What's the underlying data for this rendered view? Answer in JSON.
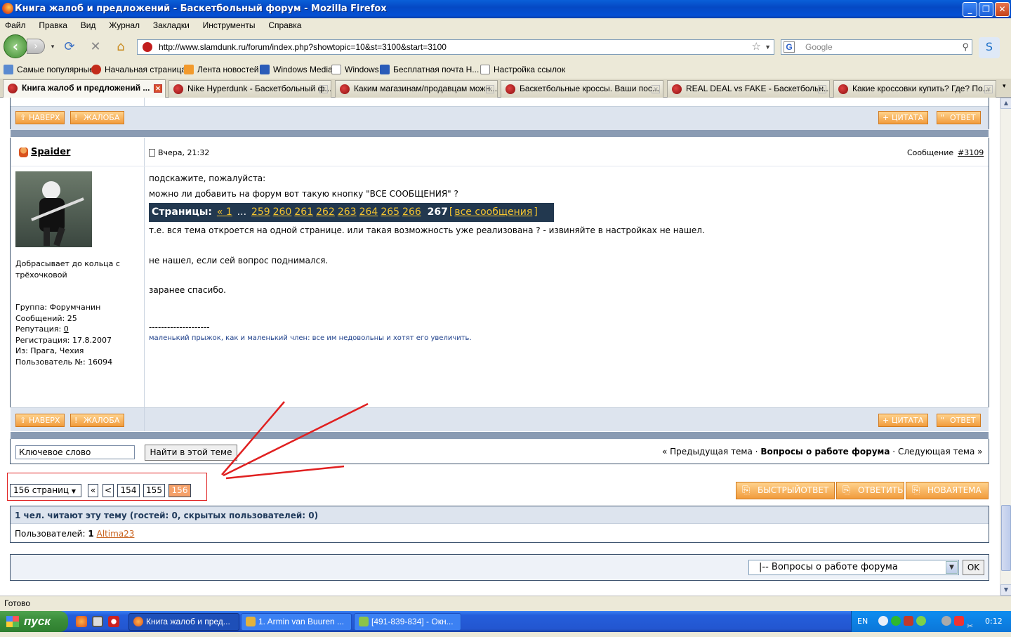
{
  "window": {
    "title": "Книга жалоб и предложений - Баскетбольный форум - Mozilla Firefox",
    "minimize": "_",
    "maximize": "❐",
    "close": "✕"
  },
  "menu": [
    "Файл",
    "Правка",
    "Вид",
    "Журнал",
    "Закладки",
    "Инструменты",
    "Справка"
  ],
  "nav": {
    "url": "http://www.slamdunk.ru/forum/index.php?showtopic=10&st=3100&start=3100",
    "search_placeholder": "Google",
    "search_engine": "G"
  },
  "bookmarks": [
    "Самые популярные",
    "Начальная страница",
    "Лента новостей",
    "Windows Media",
    "Windows",
    "Бесплатная почта Н...",
    "Настройка ссылок"
  ],
  "tabs": [
    "Книга жалоб и предложений ...",
    "Nike Hyperdunk - Баскетбольный ф...",
    "Каким магазинам/продавцам можн...",
    "Баскетбольные кроссы. Ваши пос...",
    "REAL DEAL vs FAKE - Баскетбольн...",
    "Какие кроссовки купить? Где? По..."
  ],
  "buttons": {
    "top": "НАВЕРХ",
    "complaint": "ЖАЛОБА",
    "quote": "ЦИТАТА",
    "reply": "ОТВЕТ",
    "quick_reply": "БЫСТРЫЙОТВЕТ",
    "answer": "ОТВЕТИТЬ",
    "new_topic": "НОВАЯТЕМА",
    "find": "Найти в этой теме",
    "ok": "OK"
  },
  "post": {
    "author": "Spaider",
    "date": "Вчера, 21:32",
    "msg_label": "Сообщение",
    "msg_num": "#3109",
    "rank": "Добрасывает до кольца с трёхочковой",
    "info": {
      "group": "Группа: Форумчанин",
      "posts": "Сообщений: 25",
      "rep_label": "Репутация:",
      "rep_value": "0",
      "reg": "Регистрация: 17.8.2007",
      "from": "Из: Прага, Чехия",
      "user_no": "Пользователь №: 16094"
    },
    "line1": "подскажите, пожалуйста:",
    "line2": "можно ли добавить на форум вот такую кнопку \"ВСЕ СООБЩЕНИЯ\" ?",
    "pages_label": "Страницы:",
    "pages_first": "« 1",
    "pages_dots": "...",
    "pages": [
      "259",
      "260",
      "261",
      "262",
      "263",
      "264",
      "265",
      "266"
    ],
    "pages_current": "267",
    "all_msgs": "все сообщения",
    "line3": "т.е. вся тема откроется на одной странице. или такая возможность уже реализована ? - извиняйте в настройках не нашел.",
    "line4": "не нашел, если сей вопрос поднимался.",
    "line5": "заранее спасибо.",
    "sig_sep": "--------------------",
    "signature": "маленький прыжок, как и маленький член: все им недовольны и хотят его увеличить."
  },
  "search": {
    "keyword": "Ключевое слово"
  },
  "topic_nav": {
    "prev": "« Предыдущая тема",
    "dot1": "·",
    "forum": "Вопросы о работе форума",
    "dot2": "·",
    "next": "Следующая тема »"
  },
  "pager": {
    "pages_select": "156 страниц",
    "first": "«",
    "prev": "<",
    "p1": "154",
    "p2": "155",
    "current": "156"
  },
  "readers": {
    "summary": "1 чел. читают эту тему (гостей: 0, скрытых пользователей: 0)",
    "users_label": "Пользователей:",
    "users_count": "1",
    "user": "Altima23"
  },
  "jump": {
    "selected": "|-- Вопросы о работе форума"
  },
  "status": "Готово",
  "taskbar": {
    "start": "пуск",
    "tasks": [
      "Книга жалоб и пред...",
      "1. Armin van Buuren ...",
      "[491-839-834] - Окн..."
    ],
    "lang": "EN",
    "time": "0:12"
  }
}
